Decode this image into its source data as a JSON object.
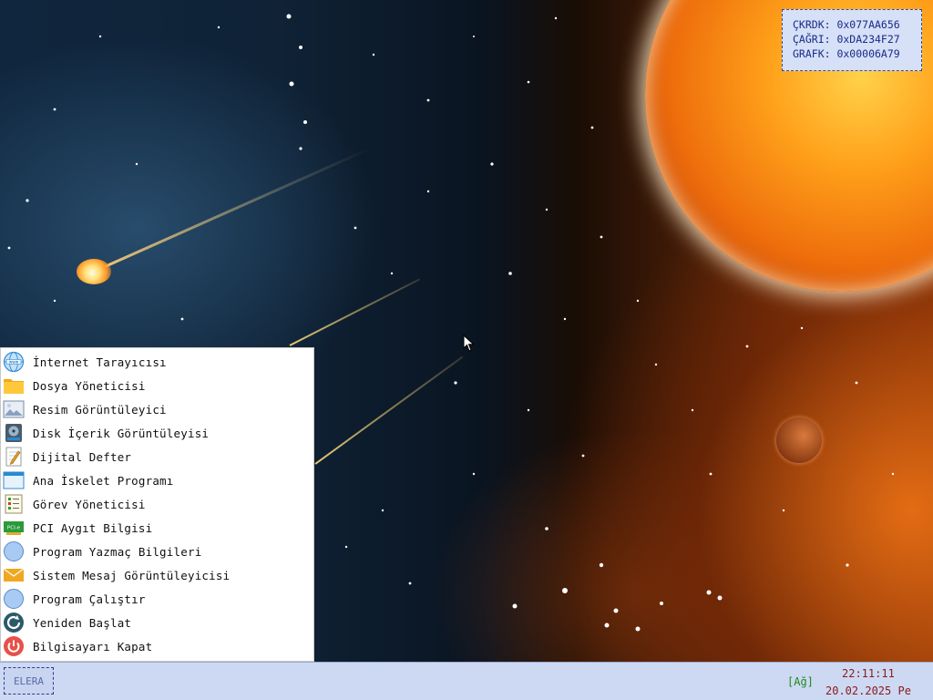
{
  "registers": {
    "kernel": "ÇKRDK: 0x077AA656",
    "call": "ÇAĞRI: 0xDA234F27",
    "graphics": "GRAFK: 0x00006A79"
  },
  "start_menu": {
    "items": [
      {
        "label": "İnternet Tarayıcısı",
        "icon": "globe-www-icon"
      },
      {
        "label": "Dosya Yöneticisi",
        "icon": "folder-icon"
      },
      {
        "label": "Resim Görüntüleyici",
        "icon": "image-viewer-icon"
      },
      {
        "label": "Disk İçerik Görüntüleyisi",
        "icon": "disk-icon"
      },
      {
        "label": "Dijital Defter",
        "icon": "notepad-icon"
      },
      {
        "label": "Ana İskelet Programı",
        "icon": "window-icon"
      },
      {
        "label": "Görev Yöneticisi",
        "icon": "task-list-icon"
      },
      {
        "label": "PCI Aygıt Bilgisi",
        "icon": "pci-card-icon"
      },
      {
        "label": "Program Yazmaç Bilgileri",
        "icon": "circle-app-icon"
      },
      {
        "label": "Sistem Mesaj Görüntüleyicisi",
        "icon": "envelope-icon"
      },
      {
        "label": "Program Çalıştır",
        "icon": "circle-app-icon"
      },
      {
        "label": "Yeniden Başlat",
        "icon": "restart-icon"
      },
      {
        "label": "Bilgisayarı Kapat",
        "icon": "power-icon"
      }
    ]
  },
  "taskbar": {
    "start_label": "ELERA",
    "network": "[Ağ]",
    "time": "22:11:11",
    "date": "20.02.2025 Pe"
  },
  "colors": {
    "taskbar_bg": "#cdd9f3",
    "register_box_bg": "#d6e0f6",
    "register_text": "#1a2a8a",
    "clock_text": "#8a1a1a",
    "network_text": "#1c8a1c"
  }
}
